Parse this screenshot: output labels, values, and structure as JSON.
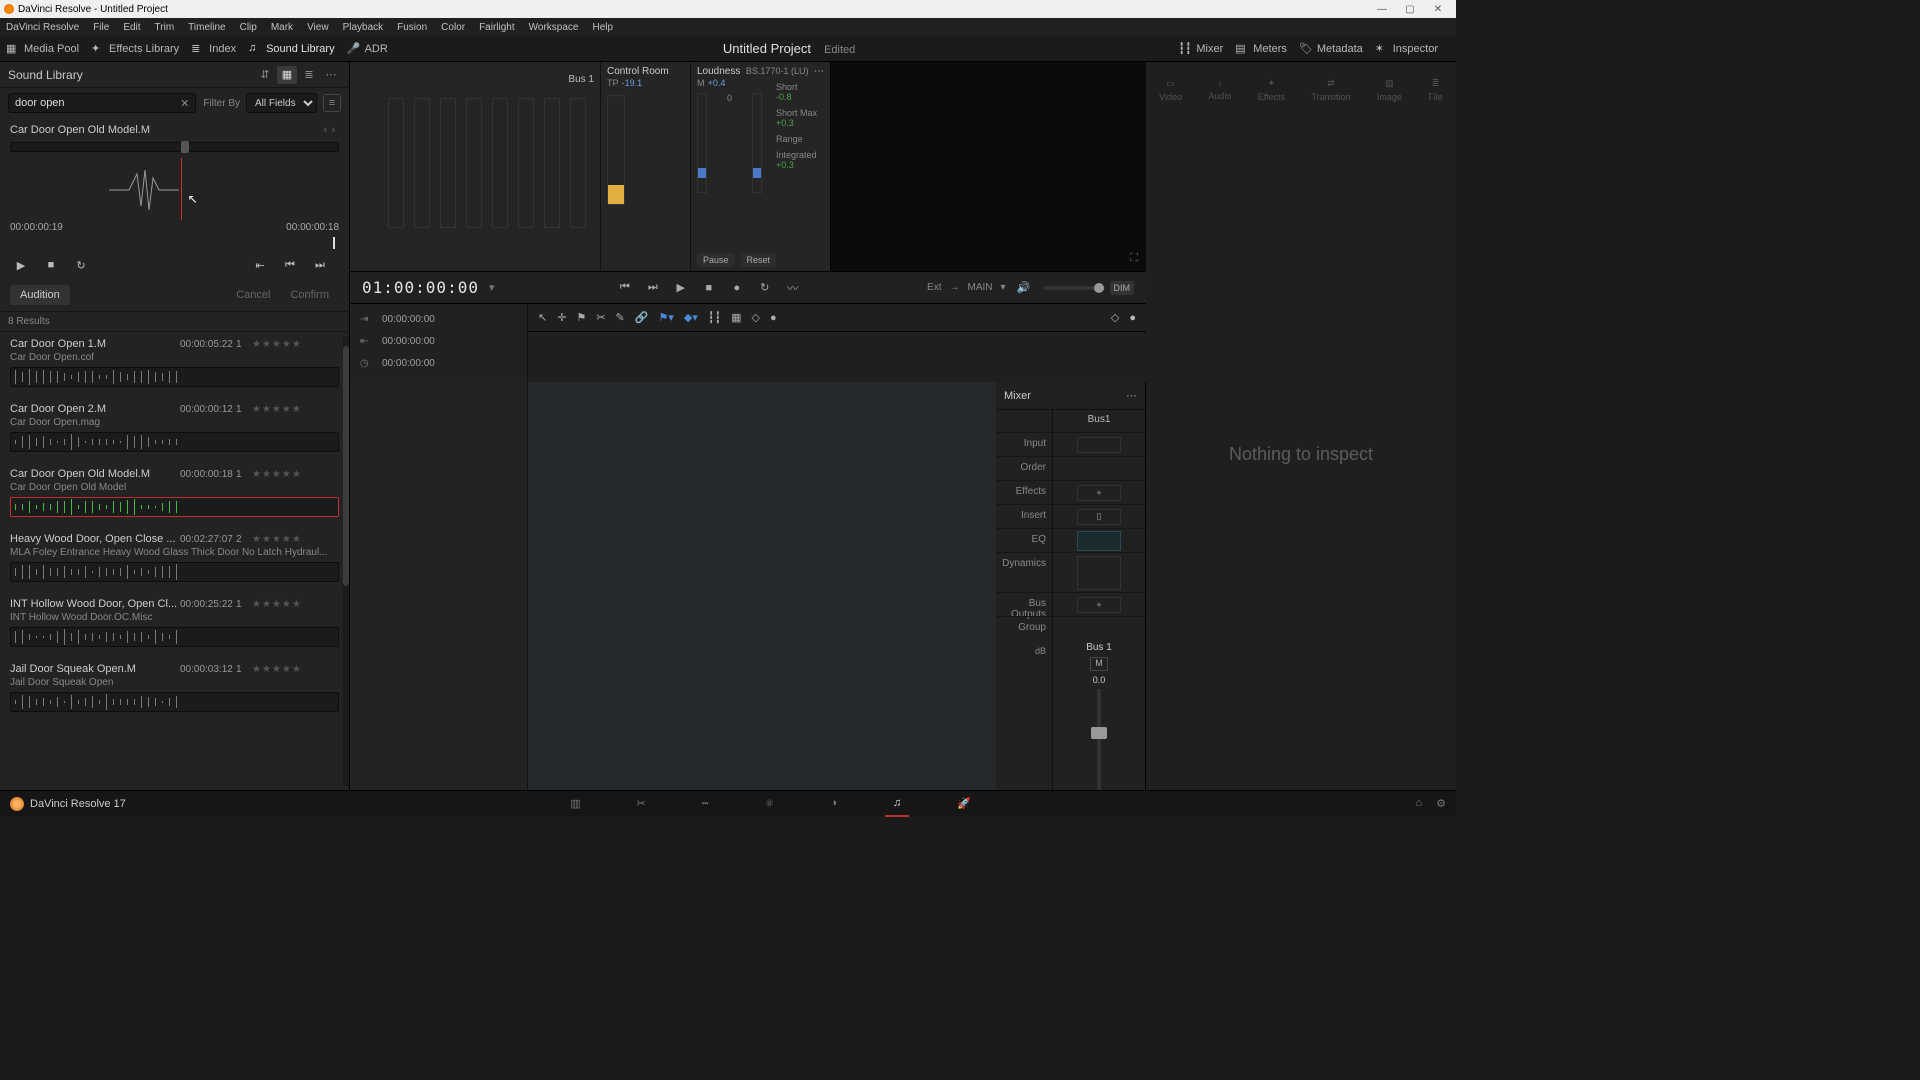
{
  "window": {
    "title": "DaVinci Resolve - Untitled Project"
  },
  "menus": [
    "DaVinci Resolve",
    "File",
    "Edit",
    "Trim",
    "Timeline",
    "Clip",
    "Mark",
    "View",
    "Playback",
    "Fusion",
    "Color",
    "Fairlight",
    "Workspace",
    "Help"
  ],
  "toolstrip": {
    "left": [
      {
        "id": "media-pool",
        "label": "Media Pool"
      },
      {
        "id": "effects-library",
        "label": "Effects Library"
      },
      {
        "id": "index",
        "label": "Index"
      },
      {
        "id": "sound-library",
        "label": "Sound Library"
      },
      {
        "id": "adr",
        "label": "ADR"
      }
    ],
    "project_title": "Untitled Project",
    "project_status": "Edited",
    "right": [
      {
        "id": "mixer",
        "label": "Mixer"
      },
      {
        "id": "meters",
        "label": "Meters"
      },
      {
        "id": "metadata",
        "label": "Metadata"
      },
      {
        "id": "inspector",
        "label": "Inspector"
      }
    ]
  },
  "sound_library": {
    "title": "Sound Library",
    "search_value": "door open",
    "filter_label": "Filter By",
    "filter_field": "All Fields",
    "preview": {
      "name": "Car Door Open Old Model.M",
      "pos": "00:00:00:19",
      "dur": "00:00:00:18"
    },
    "audition": "Audition",
    "cancel": "Cancel",
    "confirm": "Confirm",
    "results_label": "8 Results",
    "items": [
      {
        "name": "Car Door Open 1.M",
        "dur": "00:00:05:22",
        "ch": "1",
        "desc": "Car Door Open.cof"
      },
      {
        "name": "Car Door Open 2.M",
        "dur": "00:00:00:12",
        "ch": "1",
        "desc": "Car Door Open.mag"
      },
      {
        "name": "Car Door Open Old Model.M",
        "dur": "00:00:00:18",
        "ch": "1",
        "desc": "Car Door Open Old Model",
        "selected": true
      },
      {
        "name": "Heavy Wood Door, Open Close ...",
        "dur": "00:02:27:07",
        "ch": "2",
        "desc": "MLA Foley Entrance Heavy Wood Glass Thick Door No Latch Hydraul..."
      },
      {
        "name": "INT Hollow Wood Door, Open Cl...",
        "dur": "00:00:25:22",
        "ch": "1",
        "desc": "INT Hollow Wood Door.OC.Misc"
      },
      {
        "name": "Jail Door Squeak Open.M",
        "dur": "00:00:03:12",
        "ch": "1",
        "desc": "Jail Door Squeak Open"
      }
    ]
  },
  "center": {
    "bus_label": "Bus 1",
    "control_room": "Control Room",
    "tp_label": "TP",
    "tp_value": "-19.1",
    "loudness_label": "Loudness",
    "loudness_spec": "BS.1770-1 (LU)",
    "m_label": "M",
    "m_value": "+0.4",
    "short": "Short",
    "short_v": "-0.8",
    "shortmax": "Short Max",
    "shortmax_v": "+0.3",
    "range": "Range",
    "integrated": "Integrated",
    "integrated_v": "+0.3",
    "pause": "Pause",
    "reset": "Reset",
    "tc_main": "01:00:00:00",
    "tc1": "00:00:00:00",
    "tc2": "00:00:00:00",
    "tc3": "00:00:00:00",
    "ext": "Ext",
    "main_out": "MAIN",
    "dim": "DIM"
  },
  "mixer": {
    "title": "Mixer",
    "strip": "Bus1",
    "rows": [
      "Input",
      "Order",
      "Effects",
      "Insert",
      "EQ",
      "Dynamics",
      "Bus Outputs",
      "Group"
    ],
    "db_label": "dB",
    "bus_name": "Bus 1",
    "fader_val": "0.0"
  },
  "inspector": {
    "tabs": [
      "Video",
      "Audio",
      "Effects",
      "Transition",
      "Image",
      "File"
    ],
    "empty": "Nothing to inspect"
  },
  "pagebar": {
    "brand": "DaVinci Resolve 17"
  }
}
